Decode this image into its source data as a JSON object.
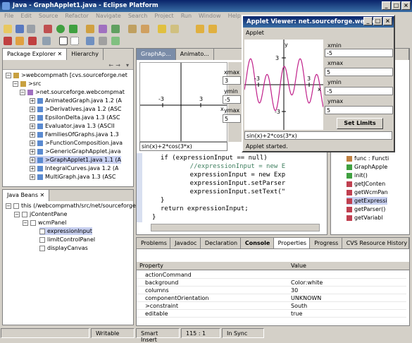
{
  "window": {
    "title": "Java - GraphApplet1.java - Eclipse Platform"
  },
  "menu": [
    "File",
    "Edit",
    "Source",
    "Refactor",
    "Navigate",
    "Search",
    "Project",
    "Run",
    "Window",
    "Help"
  ],
  "package_explorer": {
    "tabs": [
      "Package Explorer",
      "Hierarchy"
    ],
    "items": [
      ">webcompmath [cvs.sourceforge.net",
      ">src",
      ">net.sourceforge.webcompmat",
      "AnimatedGraph.java 1.2 (A",
      ">Derivatives.java 1.2 (ASC",
      "EpsilonDelta.java 1.3 (ASC",
      "Evaluator.java 1.3 (ASCII",
      "FamiliesOfGraphs.java 1.3",
      ">FunctionComposition.java",
      ">GenericGraphApplet.java",
      ">GraphApplet1.java 1.1 (A",
      "IntegralCurves.java 1.2 (A",
      "MultiGraph.java 1.3 (ASC"
    ]
  },
  "java_beans": {
    "tab": "Java Beans",
    "items": [
      "this (/webcompmath/src/net/sourceforge/w",
      "jContentPane",
      "wcmPanel",
      "expressionInput",
      "limitControlPanel",
      "displayCanvas"
    ]
  },
  "editor": {
    "tabs": [
      "GraphAp...",
      "Animato..."
    ],
    "graph": {
      "xmin": "-3",
      "xmax": "3",
      "ymin": "-5",
      "ymax": "5",
      "input": "sin(x)+2*cos(3*x)"
    },
    "side_fields": [
      "-5",
      "5",
      "5"
    ],
    "side_labels": [
      "xmax",
      "ymin",
      "ymax"
    ],
    "code_lines": [
      "if (expressionInput == null)",
      "    //expressionInput = new E",
      "    expressionInput = new Exp",
      "    expressionInput.setParser",
      "    expressionInput.setText(\"",
      "}",
      "return expressionInput;",
      "}"
    ]
  },
  "outline": {
    "items": [
      "func : Functi",
      "GraphApple",
      "init()",
      "getJConten",
      "getWcmPan",
      "getExpressi",
      "getParser()",
      "getVariabl"
    ]
  },
  "bottom": {
    "tabs": [
      "Problems",
      "Javadoc",
      "Declaration",
      "Console",
      "Properties",
      "Progress",
      "CVS Resource History"
    ],
    "columns": [
      "Property",
      "Value"
    ],
    "rows": [
      {
        "p": "actionCommand",
        "v": ""
      },
      {
        "p": "background",
        "v": "Color:white"
      },
      {
        "p": "columns",
        "v": "30"
      },
      {
        "p": "componentOrientation",
        "v": "UNKNOWN"
      },
      {
        "p": ">constraint",
        "v": "South"
      },
      {
        "p": "editable",
        "v": "true"
      }
    ]
  },
  "applet": {
    "title": "Applet Viewer: net.sourceforge.webco...",
    "menu": "Applet",
    "labels": {
      "xmin": "xmin",
      "xmax": "xmax",
      "ymin": "ymin",
      "ymax": "ymax",
      "x": "x",
      "y": "y"
    },
    "values": {
      "xmin": "-5",
      "xmax": "5",
      "ymin": "-5",
      "ymax": "5"
    },
    "ticks": {
      "xneg": "-3",
      "xpos": "3",
      "ypos": "3",
      "yneg": "-3"
    },
    "button": "Set Limits",
    "input": "sin(x)+2*cos(3*x)",
    "status": "Applet started."
  },
  "status": {
    "mode": "Writable",
    "insert": "Smart Insert",
    "pos": "115 : 1",
    "sync": "In Sync"
  },
  "colors": {
    "accent": "#0a246a",
    "curve": "#c0208a",
    "selection": "#c8d0f0"
  }
}
